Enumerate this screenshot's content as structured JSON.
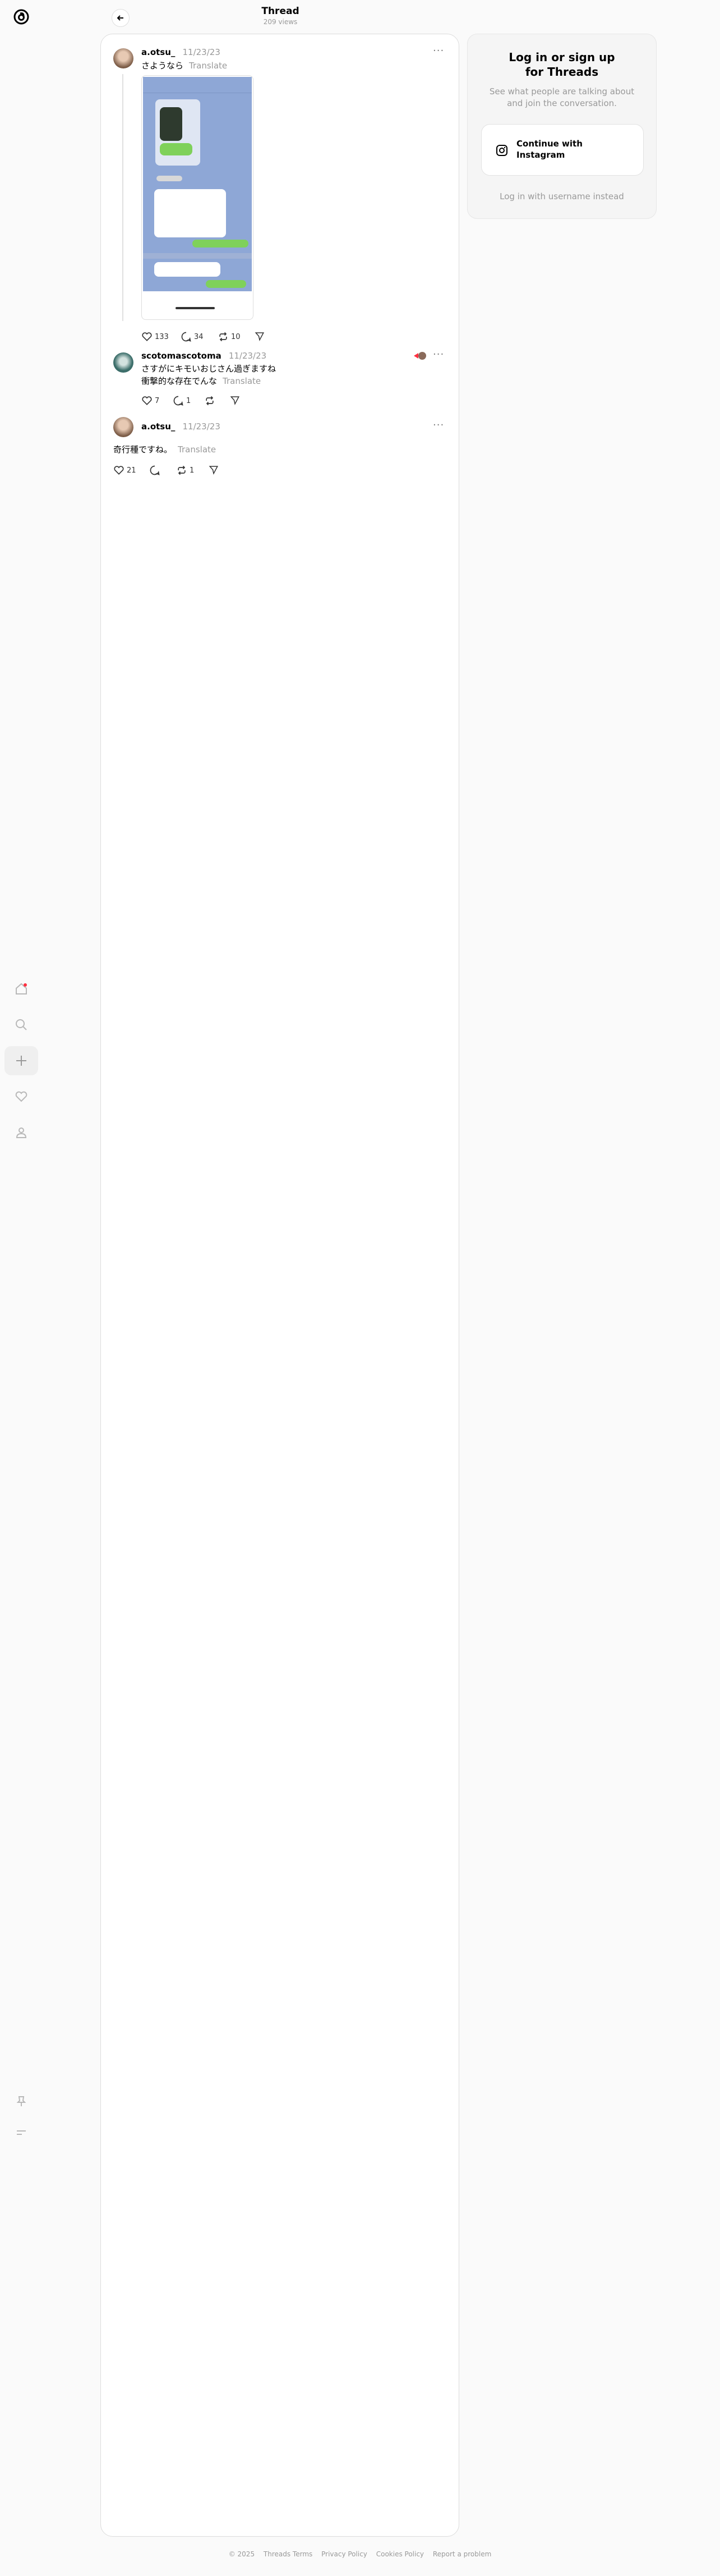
{
  "header": {
    "title": "Thread",
    "views": "209 views"
  },
  "nav": {
    "items": [
      "home-icon",
      "search-icon",
      "plus-icon",
      "heart-icon",
      "profile-icon"
    ],
    "bottom": [
      "pin-icon",
      "menu-icon"
    ]
  },
  "posts": [
    {
      "username": "a.otsu_",
      "date": "11/23/23",
      "text": "さようなら",
      "translate": "Translate",
      "likes": "133",
      "replies": "34",
      "reposts": "10"
    },
    {
      "username": "scotomascotoma",
      "date": "11/23/23",
      "text_line1": "さすがにキモいおじさん過ぎますね",
      "text_line2": "衝撃的な存在でんな",
      "translate": "Translate",
      "likes": "7",
      "replies": "1"
    },
    {
      "username": "a.otsu_",
      "date": "11/23/23",
      "text": "奇行種ですね。",
      "translate": "Translate",
      "likes": "21",
      "reposts": "1"
    }
  ],
  "login": {
    "title_line1": "Log in or sign up",
    "title_line2": "for Threads",
    "subtitle_line1": "See what people are talking about",
    "subtitle_line2": "and join the conversation.",
    "button_line1": "Continue with",
    "button_line2": "Instagram",
    "alt": "Log in with username instead"
  },
  "footer": {
    "copyright": "© 2025",
    "terms": "Threads Terms",
    "privacy": "Privacy Policy",
    "cookies": "Cookies Policy",
    "report": "Report a problem"
  },
  "colors": {
    "accent": "#000000",
    "muted": "#999999",
    "notification": "#ff3040",
    "line_green": "#7fd15a"
  }
}
